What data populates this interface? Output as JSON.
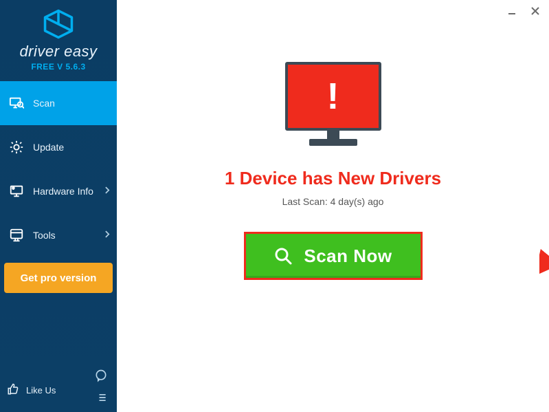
{
  "app": {
    "name_part1": "driver",
    "name_part2": "easy",
    "version_label": "FREE V 5.6.3"
  },
  "sidebar": {
    "items": [
      {
        "label": "Scan",
        "has_chevron": false
      },
      {
        "label": "Update",
        "has_chevron": false
      },
      {
        "label": "Hardware Info",
        "has_chevron": true
      },
      {
        "label": "Tools",
        "has_chevron": true
      }
    ],
    "pro_button": "Get pro version",
    "like_us": "Like Us"
  },
  "main": {
    "monitor_warning_glyph": "!",
    "headline": "1 Device has New Drivers",
    "last_scan": "Last Scan: 4 day(s) ago",
    "scan_button": "Scan Now"
  },
  "colors": {
    "accent_blue": "#00a2e8",
    "sidebar_bg": "#0b3d64",
    "alert_red": "#ef2b1d",
    "scan_green": "#3fbf1f",
    "pro_orange": "#f5a623"
  }
}
